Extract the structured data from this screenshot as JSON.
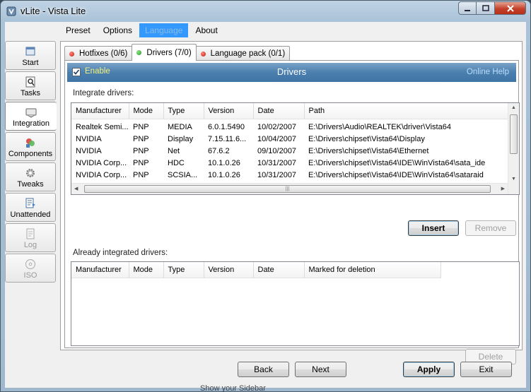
{
  "window": {
    "title": "vLite - Vista Lite",
    "caption": {
      "min": "0",
      "max": "1",
      "close": "r"
    }
  },
  "menu": [
    "Preset",
    "Options",
    "Language",
    "About"
  ],
  "sidebar": [
    {
      "label": "Start",
      "icon": "start-icon",
      "state": "normal"
    },
    {
      "label": "Tasks",
      "icon": "tasks-icon",
      "state": "normal"
    },
    {
      "label": "Integration",
      "icon": "integration-icon",
      "state": "active"
    },
    {
      "label": "Components",
      "icon": "components-icon",
      "state": "normal"
    },
    {
      "label": "Tweaks",
      "icon": "tweaks-icon",
      "state": "normal"
    },
    {
      "label": "Unattended",
      "icon": "unattended-icon",
      "state": "normal"
    },
    {
      "label": "Log",
      "icon": "log-icon",
      "state": "disabled"
    },
    {
      "label": "ISO",
      "icon": "iso-icon",
      "state": "disabled"
    }
  ],
  "tabs": [
    {
      "label": "Hotfixes (0/6)",
      "status": "red"
    },
    {
      "label": "Drivers (7/0)",
      "status": "green"
    },
    {
      "label": "Language pack (0/1)",
      "status": "red"
    }
  ],
  "header": {
    "enable_label": "Enable",
    "enable_checked": true,
    "title": "Drivers",
    "help": "Online Help"
  },
  "integrate": {
    "label": "Integrate drivers:",
    "columns": [
      "Manufacturer",
      "Mode",
      "Type",
      "Version",
      "Date",
      "Path"
    ],
    "rows": [
      [
        "Realtek Semi...",
        "PNP",
        "MEDIA",
        "6.0.1.5490",
        "10/02/2007",
        "E:\\Drivers\\Audio\\REALTEK\\driver\\Vista64"
      ],
      [
        "NVIDIA",
        "PNP",
        "Display",
        "7.15.11.6...",
        "10/04/2007",
        "E:\\Drivers\\chipset\\Vista64\\Display"
      ],
      [
        "NVIDIA",
        "PNP",
        "Net",
        "67.6.2",
        "09/10/2007",
        "E:\\Drivers\\chipset\\Vista64\\Ethernet"
      ],
      [
        "NVIDIA Corp...",
        "PNP",
        "HDC",
        "10.1.0.26",
        "10/31/2007",
        "E:\\Drivers\\chipset\\Vista64\\IDE\\WinVista64\\sata_ide"
      ],
      [
        "NVIDIA Corp...",
        "PNP",
        "SCSIA...",
        "10.1.0.26",
        "10/31/2007",
        "E:\\Drivers\\chipset\\Vista64\\IDE\\WinVista64\\sataraid"
      ]
    ],
    "insert": "Insert",
    "remove": "Remove"
  },
  "integrated": {
    "label": "Already integrated drivers:",
    "columns": [
      "Manufacturer",
      "Mode",
      "Type",
      "Version",
      "Date",
      "Marked for deletion"
    ],
    "delete": "Delete"
  },
  "footer": {
    "back": "Back",
    "next": "Next",
    "apply": "Apply",
    "exit": "Exit"
  },
  "background_text": "Show your Sidebar"
}
